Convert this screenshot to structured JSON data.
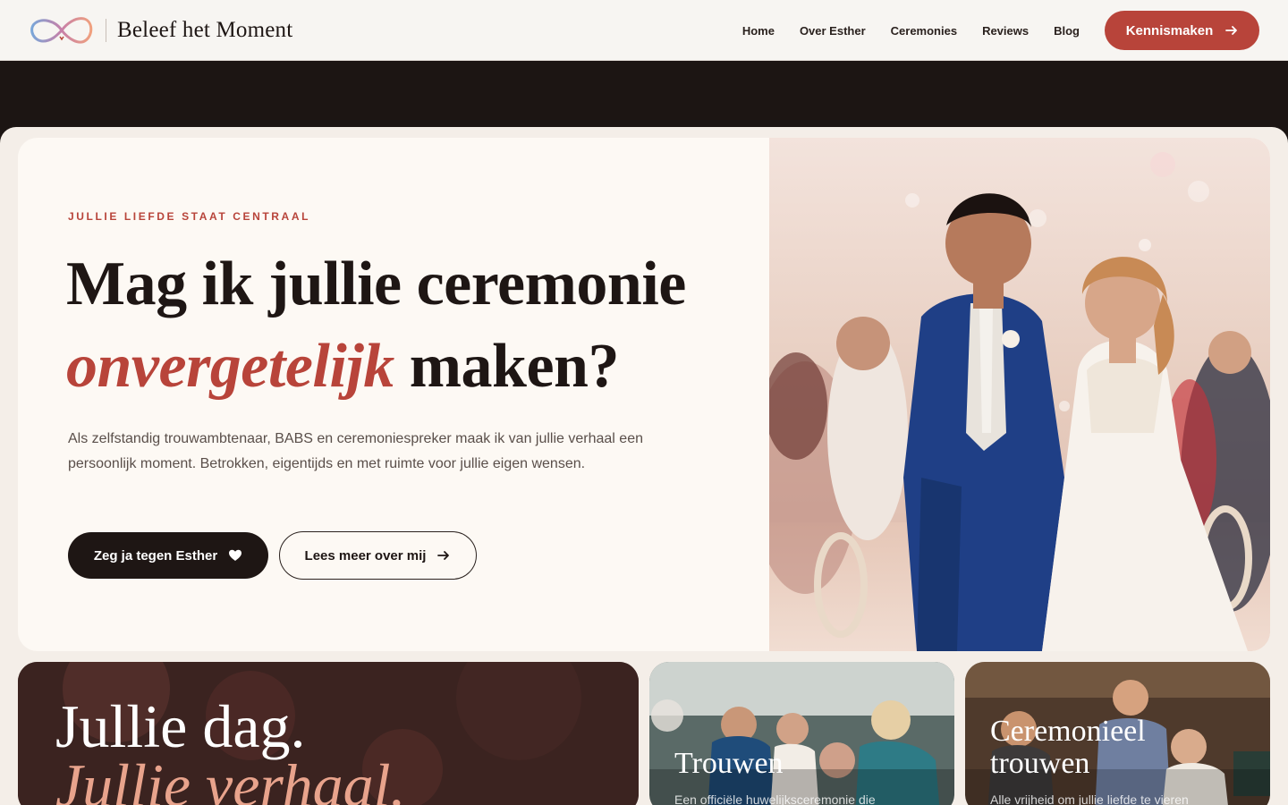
{
  "brand": {
    "name": "Beleef het Moment",
    "logo_colors": [
      "#f0a07e",
      "#7aa6d8",
      "#b8443a"
    ]
  },
  "nav": {
    "items": [
      "Home",
      "Over Esther",
      "Ceremonies",
      "Reviews",
      "Blog"
    ],
    "cta_label": "Kennismaken"
  },
  "hero": {
    "eyebrow": "JULLIE LIEFDE STAAT CENTRAAL",
    "title_line1": "Mag ik jullie ceremonie",
    "title_accent": "onvergetelijk",
    "title_end": " maken?",
    "lead": "Als zelfstandig trouwambtenaar, BABS en ceremoniespreker maak ik van jullie verhaal een persoonlijk moment. Betrokken, eigentijds en met ruimte voor jullie eigen wensen.",
    "primary_button": "Zeg ja tegen Esther",
    "secondary_button": "Lees meer over mij"
  },
  "cards": {
    "feature": {
      "line1": "Jullie dag.",
      "line2": "Jullie verhaal."
    },
    "trouwen": {
      "title": "Trouwen",
      "desc": "Een officiële huwelijksceremonie die"
    },
    "ceremonieel": {
      "title": "Ceremonieel trouwen",
      "desc": "Alle vrijheid om jullie liefde te vieren"
    }
  },
  "colors": {
    "accent": "#b8443a",
    "dark": "#1e1614",
    "cream": "#fdf9f4",
    "peach": "#e8a38c"
  }
}
